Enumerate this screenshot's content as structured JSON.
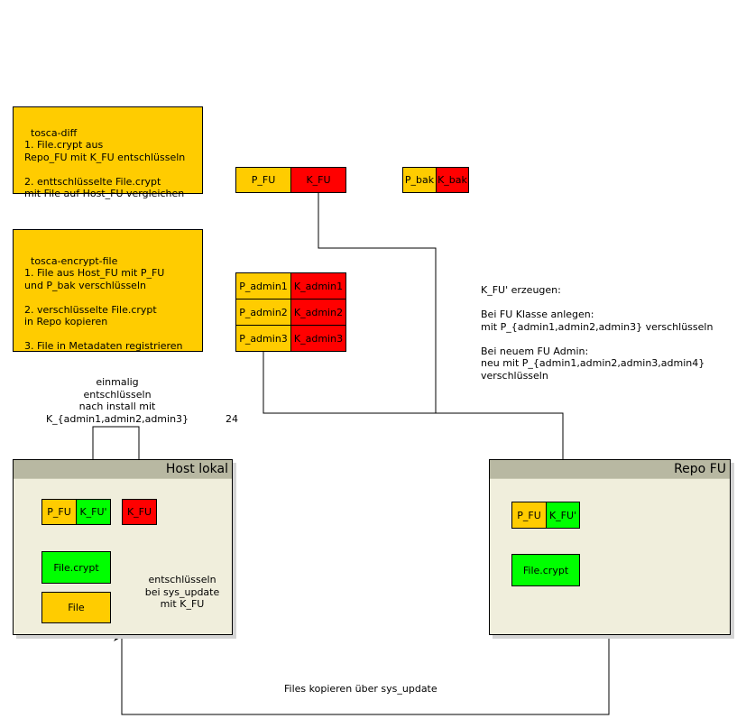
{
  "notes": {
    "tosca_diff": "tosca-diff\n1. File.crypt aus\nRepo_FU mit K_FU entschlüsseln\n\n2. enttschlüsselte File.crypt\nmit File auf Host_FU vergleichen",
    "tosca_encrypt": "tosca-encrypt-file\n1. File aus Host_FU mit P_FU\nund P_bak verschlüsseln\n\n2. verschlüsselte File.crypt\nin Repo kopieren\n\n3. File in Metadaten registrieren"
  },
  "keys": {
    "p_fu": "P_FU",
    "k_fu": "K_FU",
    "p_bak": "P_bak",
    "k_bak": "K_bak",
    "admins": [
      {
        "p": "P_admin1",
        "k": "K_admin1"
      },
      {
        "p": "P_admin2",
        "k": "K_admin2"
      },
      {
        "p": "P_admin3",
        "k": "K_admin3"
      }
    ]
  },
  "kfu_text": "K_FU' erzeugen:\n\nBei FU Klasse anlegen:\nmit P_{admin1,admin2,admin3} verschlüsseln\n\nBei neuem FU Admin:\nneu mit P_{admin1,admin2,admin3,admin4}\nverschlüsseln",
  "once_decrypt_text": "einmalig\nentschlüsseln\nnach install mit\nK_{admin1,admin2,admin3}",
  "stray_number": "24",
  "host": {
    "title": "Host lokal",
    "p_fu": "P_FU",
    "k_fu_prime": "K_FU'",
    "k_fu": "K_FU",
    "file_crypt": "File.crypt",
    "file": "File",
    "decrypt_text": "entschlüsseln\nbei sys_update\nmit K_FU"
  },
  "repo": {
    "title": "Repo FU",
    "p_fu": "P_FU",
    "k_fu_prime": "K_FU'",
    "file_crypt": "File.crypt"
  },
  "copy_text": "Files kopieren über sys_update",
  "colors": {
    "private_key": "#ffcc00",
    "secret_key": "#ff0000",
    "encrypted": "#00ff00",
    "container_bg": "#f0eedc",
    "container_header": "#b8b8a2"
  }
}
